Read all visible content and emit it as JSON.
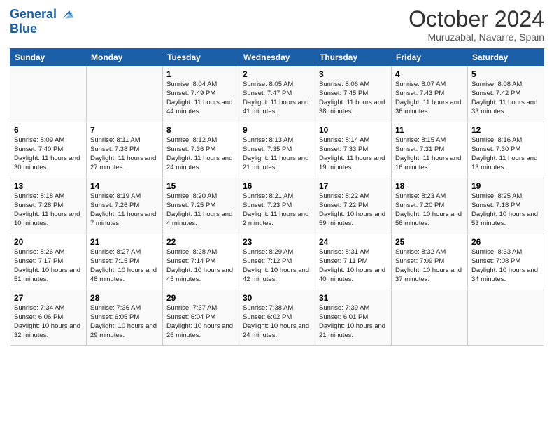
{
  "header": {
    "logo_line1": "General",
    "logo_line2": "Blue",
    "month_title": "October 2024",
    "location": "Muruzabal, Navarre, Spain"
  },
  "weekdays": [
    "Sunday",
    "Monday",
    "Tuesday",
    "Wednesday",
    "Thursday",
    "Friday",
    "Saturday"
  ],
  "weeks": [
    [
      {
        "day": "",
        "text": ""
      },
      {
        "day": "",
        "text": ""
      },
      {
        "day": "1",
        "text": "Sunrise: 8:04 AM\nSunset: 7:49 PM\nDaylight: 11 hours and 44 minutes."
      },
      {
        "day": "2",
        "text": "Sunrise: 8:05 AM\nSunset: 7:47 PM\nDaylight: 11 hours and 41 minutes."
      },
      {
        "day": "3",
        "text": "Sunrise: 8:06 AM\nSunset: 7:45 PM\nDaylight: 11 hours and 38 minutes."
      },
      {
        "day": "4",
        "text": "Sunrise: 8:07 AM\nSunset: 7:43 PM\nDaylight: 11 hours and 36 minutes."
      },
      {
        "day": "5",
        "text": "Sunrise: 8:08 AM\nSunset: 7:42 PM\nDaylight: 11 hours and 33 minutes."
      }
    ],
    [
      {
        "day": "6",
        "text": "Sunrise: 8:09 AM\nSunset: 7:40 PM\nDaylight: 11 hours and 30 minutes."
      },
      {
        "day": "7",
        "text": "Sunrise: 8:11 AM\nSunset: 7:38 PM\nDaylight: 11 hours and 27 minutes."
      },
      {
        "day": "8",
        "text": "Sunrise: 8:12 AM\nSunset: 7:36 PM\nDaylight: 11 hours and 24 minutes."
      },
      {
        "day": "9",
        "text": "Sunrise: 8:13 AM\nSunset: 7:35 PM\nDaylight: 11 hours and 21 minutes."
      },
      {
        "day": "10",
        "text": "Sunrise: 8:14 AM\nSunset: 7:33 PM\nDaylight: 11 hours and 19 minutes."
      },
      {
        "day": "11",
        "text": "Sunrise: 8:15 AM\nSunset: 7:31 PM\nDaylight: 11 hours and 16 minutes."
      },
      {
        "day": "12",
        "text": "Sunrise: 8:16 AM\nSunset: 7:30 PM\nDaylight: 11 hours and 13 minutes."
      }
    ],
    [
      {
        "day": "13",
        "text": "Sunrise: 8:18 AM\nSunset: 7:28 PM\nDaylight: 11 hours and 10 minutes."
      },
      {
        "day": "14",
        "text": "Sunrise: 8:19 AM\nSunset: 7:26 PM\nDaylight: 11 hours and 7 minutes."
      },
      {
        "day": "15",
        "text": "Sunrise: 8:20 AM\nSunset: 7:25 PM\nDaylight: 11 hours and 4 minutes."
      },
      {
        "day": "16",
        "text": "Sunrise: 8:21 AM\nSunset: 7:23 PM\nDaylight: 11 hours and 2 minutes."
      },
      {
        "day": "17",
        "text": "Sunrise: 8:22 AM\nSunset: 7:22 PM\nDaylight: 10 hours and 59 minutes."
      },
      {
        "day": "18",
        "text": "Sunrise: 8:23 AM\nSunset: 7:20 PM\nDaylight: 10 hours and 56 minutes."
      },
      {
        "day": "19",
        "text": "Sunrise: 8:25 AM\nSunset: 7:18 PM\nDaylight: 10 hours and 53 minutes."
      }
    ],
    [
      {
        "day": "20",
        "text": "Sunrise: 8:26 AM\nSunset: 7:17 PM\nDaylight: 10 hours and 51 minutes."
      },
      {
        "day": "21",
        "text": "Sunrise: 8:27 AM\nSunset: 7:15 PM\nDaylight: 10 hours and 48 minutes."
      },
      {
        "day": "22",
        "text": "Sunrise: 8:28 AM\nSunset: 7:14 PM\nDaylight: 10 hours and 45 minutes."
      },
      {
        "day": "23",
        "text": "Sunrise: 8:29 AM\nSunset: 7:12 PM\nDaylight: 10 hours and 42 minutes."
      },
      {
        "day": "24",
        "text": "Sunrise: 8:31 AM\nSunset: 7:11 PM\nDaylight: 10 hours and 40 minutes."
      },
      {
        "day": "25",
        "text": "Sunrise: 8:32 AM\nSunset: 7:09 PM\nDaylight: 10 hours and 37 minutes."
      },
      {
        "day": "26",
        "text": "Sunrise: 8:33 AM\nSunset: 7:08 PM\nDaylight: 10 hours and 34 minutes."
      }
    ],
    [
      {
        "day": "27",
        "text": "Sunrise: 7:34 AM\nSunset: 6:06 PM\nDaylight: 10 hours and 32 minutes."
      },
      {
        "day": "28",
        "text": "Sunrise: 7:36 AM\nSunset: 6:05 PM\nDaylight: 10 hours and 29 minutes."
      },
      {
        "day": "29",
        "text": "Sunrise: 7:37 AM\nSunset: 6:04 PM\nDaylight: 10 hours and 26 minutes."
      },
      {
        "day": "30",
        "text": "Sunrise: 7:38 AM\nSunset: 6:02 PM\nDaylight: 10 hours and 24 minutes."
      },
      {
        "day": "31",
        "text": "Sunrise: 7:39 AM\nSunset: 6:01 PM\nDaylight: 10 hours and 21 minutes."
      },
      {
        "day": "",
        "text": ""
      },
      {
        "day": "",
        "text": ""
      }
    ]
  ]
}
